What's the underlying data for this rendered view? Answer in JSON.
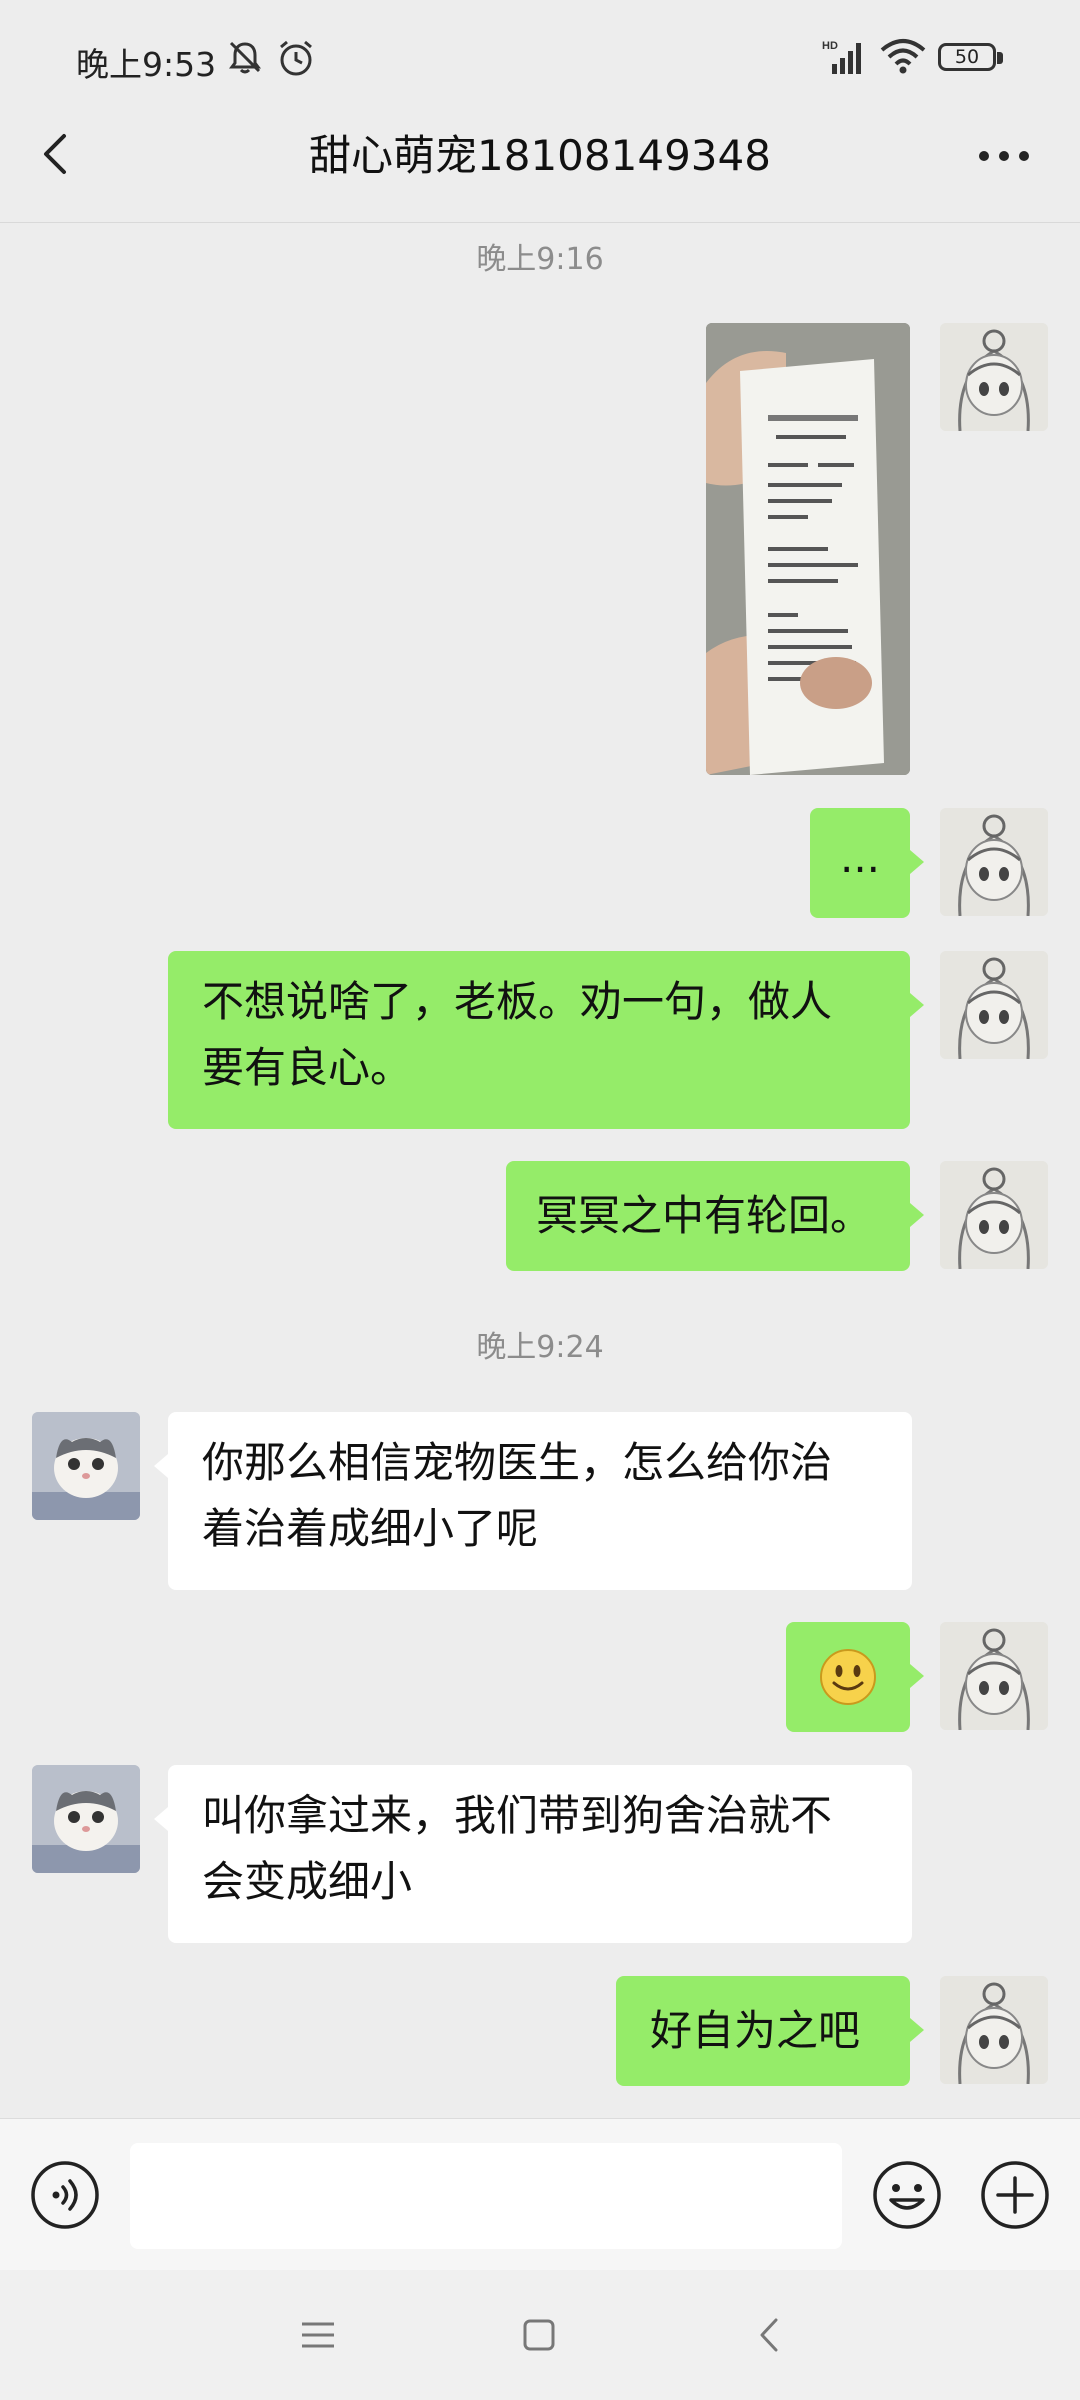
{
  "status_bar": {
    "time": "晚上9:53",
    "battery": "50",
    "icons": [
      "bell-off-icon",
      "alarm-icon",
      "hd-signal-icon",
      "wifi-icon",
      "battery-icon"
    ]
  },
  "header": {
    "title": "甜心萌宠18108149348",
    "back_icon": "chevron-left-icon",
    "more_icon": "more-dots-icon"
  },
  "timestamps": [
    "晚上9:16",
    "晚上9:24"
  ],
  "messages": [
    {
      "side": "me",
      "type": "image",
      "text": ""
    },
    {
      "side": "me",
      "type": "text",
      "text": "..."
    },
    {
      "side": "me",
      "type": "text",
      "lines": [
        "不想说啥了，老板。劝一句，做人",
        "要有良心。"
      ]
    },
    {
      "side": "me",
      "type": "text",
      "text": "冥冥之中有轮回。"
    },
    {
      "side": "other",
      "type": "text",
      "lines": [
        "你那么相信宠物医生，怎么给你治",
        "着治着成细小了呢"
      ]
    },
    {
      "side": "me",
      "type": "emoji",
      "text": "smile-emoji"
    },
    {
      "side": "other",
      "type": "text",
      "lines": [
        "叫你拿过来，我们带到狗舍治就不",
        "会变成细小"
      ]
    },
    {
      "side": "me",
      "type": "text",
      "text": "好自为之吧"
    }
  ],
  "input_bar": {
    "voice_icon": "voice-icon",
    "emoji_icon": "emoji-icon",
    "plus_icon": "plus-icon",
    "value": ""
  },
  "nav_bar": {
    "icons": [
      "menu-icon",
      "home-square-icon",
      "back-triangle-icon"
    ]
  },
  "colors": {
    "background": "#ededed",
    "my_bubble": "#95ec69",
    "their_bubble": "#ffffff"
  }
}
